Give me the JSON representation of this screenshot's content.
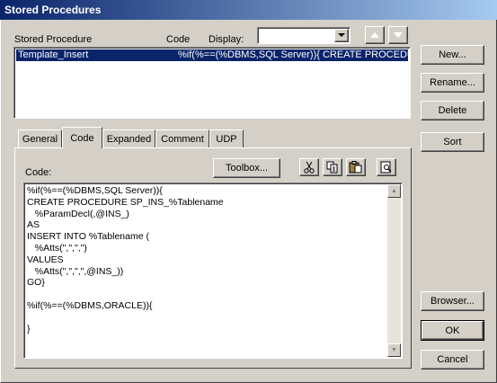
{
  "window": {
    "title": "Stored Procedures"
  },
  "list_header": {
    "col1": "Stored Procedure",
    "col2": "Code",
    "display_label": "Display:",
    "display_value": ""
  },
  "procedures": [
    {
      "name": "Template_Insert",
      "code": "%if(%==(%DBMS,SQL Server)){ CREATE PROCEDURE"
    }
  ],
  "side_buttons": {
    "new": "New...",
    "rename": "Rename...",
    "delete": "Delete",
    "sort": "Sort",
    "browser": "Browser...",
    "ok": "OK",
    "cancel": "Cancel"
  },
  "tabs": [
    "General",
    "Code",
    "Expanded",
    "Comment",
    "UDP"
  ],
  "active_tab": "Code",
  "code_panel": {
    "label": "Code:",
    "toolbox": "Toolbox..."
  },
  "code_lines": [
    "%if(%==(%DBMS,SQL Server)){",
    "CREATE PROCEDURE SP_INS_%Tablename",
    "   %ParamDecl(,@INS_)",
    "AS",
    "INSERT INTO %Tablename (",
    "   %Atts(\",\",\",\")",
    "VALUES",
    "   %Atts(\",\",\",\",@INS_))",
    "GO}",
    "",
    "%if(%==(%DBMS,ORACLE)){",
    "",
    "}"
  ],
  "icons": {
    "cut": "scissors-icon",
    "copy": "copy-icon",
    "paste": "paste-icon",
    "preview": "preview-icon"
  }
}
